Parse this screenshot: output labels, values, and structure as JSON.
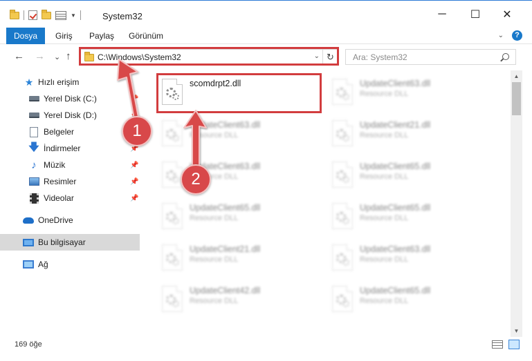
{
  "window": {
    "title": "System32",
    "controls": {
      "minimize": "─",
      "maximize": "☐",
      "close": "✕"
    }
  },
  "ribbon": {
    "tabs": [
      "Dosya",
      "Giriş",
      "Paylaş",
      "Görünüm"
    ],
    "accent": "#1979ca"
  },
  "navigation": {
    "back": "←",
    "forward": "→",
    "recent": "⌄",
    "up": "↑",
    "address": "C:\\Windows\\System32",
    "refresh": "↻",
    "search_placeholder": "Ara: System32"
  },
  "sidebar": {
    "items": [
      {
        "label": "Hızlı erişim",
        "icon": "star-icon"
      },
      {
        "label": "Yerel Disk (C:)",
        "icon": "drive-icon",
        "pinned": true
      },
      {
        "label": "Yerel Disk (D:)",
        "icon": "drive-icon",
        "pinned": true
      },
      {
        "label": "Belgeler",
        "icon": "document-icon",
        "pinned": true
      },
      {
        "label": "İndirmeler",
        "icon": "download-icon",
        "pinned": true
      },
      {
        "label": "Müzik",
        "icon": "music-icon",
        "pinned": true
      },
      {
        "label": "Resimler",
        "icon": "pictures-icon",
        "pinned": true
      },
      {
        "label": "Videolar",
        "icon": "video-icon",
        "pinned": true
      },
      {
        "label": "OneDrive",
        "icon": "onedrive-icon"
      },
      {
        "label": "Bu bilgisayar",
        "icon": "computer-icon",
        "selected": true
      },
      {
        "label": "Ağ",
        "icon": "network-icon"
      }
    ]
  },
  "files": [
    {
      "name": "scomdrpt2.dll",
      "type": ""
    },
    {
      "name": "UpdateClient63.dll",
      "type": "Resource DLL"
    },
    {
      "name": "UpdateClient63.dll",
      "type": "Resource DLL"
    },
    {
      "name": "UpdateClient21.dll",
      "type": "Resource DLL"
    },
    {
      "name": "UpdateClient63.dll",
      "type": "Resource DLL"
    },
    {
      "name": "UpdateClient65.dll",
      "type": "Resource DLL"
    },
    {
      "name": "UpdateClient65.dll",
      "type": "Resource DLL"
    },
    {
      "name": "UpdateClient65.dll",
      "type": "Resource DLL"
    },
    {
      "name": "UpdateClient21.dll",
      "type": "Resource DLL"
    },
    {
      "name": "UpdateClient63.dll",
      "type": "Resource DLL"
    },
    {
      "name": "UpdateClient42.dll",
      "type": "Resource DLL"
    },
    {
      "name": "UpdateClient65.dll",
      "type": "Resource DLL"
    }
  ],
  "status": {
    "item_count": "169 öğe"
  },
  "annotations": {
    "step1": "1",
    "step2": "2",
    "color": "#d23c3e"
  }
}
